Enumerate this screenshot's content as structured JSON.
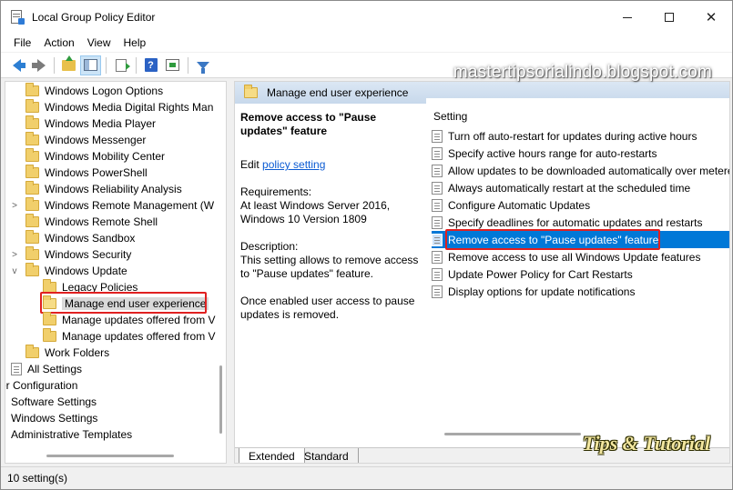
{
  "window": {
    "title": "Local Group Policy Editor"
  },
  "menu": [
    "File",
    "Action",
    "View",
    "Help"
  ],
  "tree": {
    "items": [
      {
        "label": "Windows Logon Options",
        "expander": "",
        "icon": "folder"
      },
      {
        "label": "Windows Media Digital Rights Man",
        "expander": "",
        "icon": "folder"
      },
      {
        "label": "Windows Media Player",
        "expander": "",
        "icon": "folder"
      },
      {
        "label": "Windows Messenger",
        "expander": "",
        "icon": "folder"
      },
      {
        "label": "Windows Mobility Center",
        "expander": "",
        "icon": "folder"
      },
      {
        "label": "Windows PowerShell",
        "expander": "",
        "icon": "folder"
      },
      {
        "label": "Windows Reliability Analysis",
        "expander": "",
        "icon": "folder"
      },
      {
        "label": "Windows Remote Management (W",
        "expander": ">",
        "icon": "folder"
      },
      {
        "label": "Windows Remote Shell",
        "expander": "",
        "icon": "folder"
      },
      {
        "label": "Windows Sandbox",
        "expander": "",
        "icon": "folder"
      },
      {
        "label": "Windows Security",
        "expander": ">",
        "icon": "folder"
      },
      {
        "label": "Windows Update",
        "expander": "v",
        "icon": "folder"
      },
      {
        "label": "Legacy Policies",
        "expander": "",
        "icon": "folder"
      },
      {
        "label": "Manage end user experience",
        "expander": "",
        "icon": "folder-open"
      },
      {
        "label": "Manage updates offered from V",
        "expander": "",
        "icon": "folder"
      },
      {
        "label": "Manage updates offered from V",
        "expander": "",
        "icon": "folder"
      },
      {
        "label": "Work Folders",
        "expander": "",
        "icon": "folder"
      },
      {
        "label": "All Settings",
        "expander": "",
        "icon": "doc"
      },
      {
        "label": "er Configuration",
        "expander": "",
        "icon": ""
      },
      {
        "label": "Software Settings",
        "expander": "",
        "icon": ""
      },
      {
        "label": "Windows Settings",
        "expander": "",
        "icon": ""
      },
      {
        "label": "Administrative Templates",
        "expander": "",
        "icon": ""
      }
    ]
  },
  "right": {
    "header": "Manage end user experience",
    "desc_title": "Remove access to \"Pause updates\" feature",
    "edit_prefix": "Edit ",
    "edit_link": "policy setting",
    "requirements_label": "Requirements:",
    "requirements_text": "At least Windows Server 2016, Windows 10 Version 1809",
    "description_label": "Description:",
    "description_text": "This setting allows to remove access to \"Pause updates\" feature.",
    "description_text2": "Once enabled user access to pause updates is removed.",
    "list_header": "Setting",
    "settings": [
      "Turn off auto-restart for updates during active hours",
      "Specify active hours range for auto-restarts",
      "Allow updates to be downloaded automatically over metered",
      "Always automatically restart at the scheduled time",
      "Configure Automatic Updates",
      "Specify deadlines for automatic updates and restarts",
      "Remove access to \"Pause updates\" feature",
      "Remove access to use all Windows Update features",
      "Update Power Policy for Cart Restarts",
      "Display options for update notifications"
    ],
    "tabs": [
      "Extended",
      "Standard"
    ]
  },
  "status": "10 setting(s)",
  "watermark": "mastertipsorialindo.blogspot.com",
  "watermark2": "Tips & Tutorial",
  "colors": {
    "selection": "#0078d7",
    "highlight_box": "#e02020",
    "link": "#0b5bd3"
  }
}
